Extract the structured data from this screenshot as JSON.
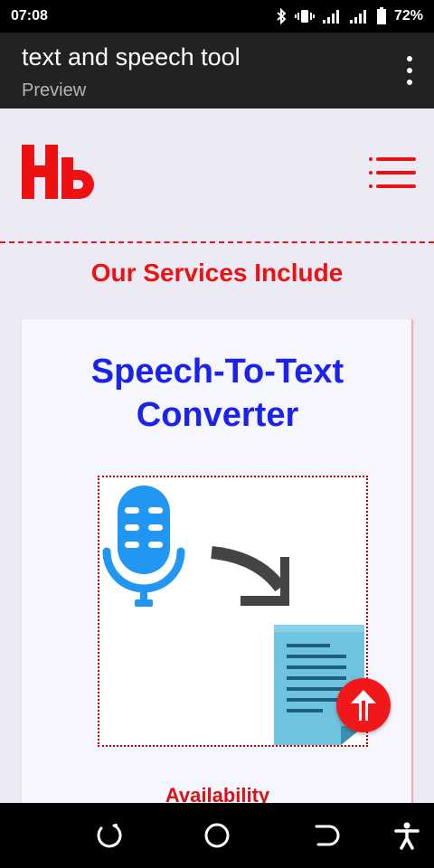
{
  "status_bar": {
    "time": "07:08",
    "battery": "72%",
    "icons": [
      "bluetooth-icon",
      "vibrate-icon",
      "signal-icon",
      "signal-icon",
      "battery-icon"
    ]
  },
  "app_bar": {
    "title": "text and speech tool",
    "subtitle": "Preview",
    "menu_icon": "more-vert-icon"
  },
  "site": {
    "logo_text": "Hь",
    "menu_icon": "hamburger-icon",
    "section_title": "Our Services Include",
    "card": {
      "title": "Speech-To-Text Converter",
      "image_icons": [
        "microphone-icon",
        "curved-arrow-icon",
        "document-icon"
      ],
      "availability_label": "Availability"
    },
    "scroll_top_icon": "double-up-arrow-icon"
  },
  "nav_bar": {
    "icons": [
      "recents-icon",
      "home-icon",
      "back-icon",
      "accessibility-icon"
    ]
  },
  "colors": {
    "accent_red": "#ee1111",
    "title_blue": "#1a22ee",
    "mic_blue": "#2196f3",
    "app_bar": "#222222",
    "page_bg": "#eceaf4"
  }
}
